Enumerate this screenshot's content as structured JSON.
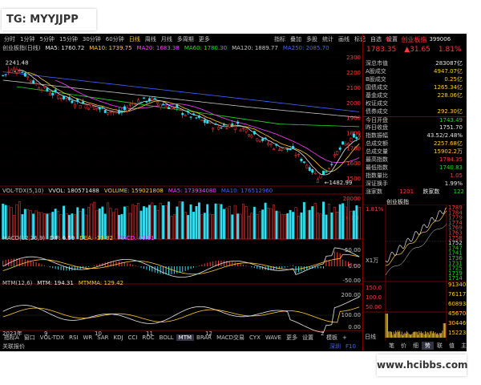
{
  "watermark_tl": "TG: MYYJJPP",
  "watermark_br": "www.hcibbs.com",
  "toolbar": {
    "left": [
      {
        "label": "分时",
        "active": false
      },
      {
        "label": "1分钟",
        "active": false
      },
      {
        "label": "5分钟",
        "active": false
      },
      {
        "label": "15分钟",
        "active": false
      },
      {
        "label": "30分钟",
        "active": false
      },
      {
        "label": "60分钟",
        "active": false
      },
      {
        "label": "日线",
        "active": true
      },
      {
        "label": "周线",
        "active": false
      },
      {
        "label": "月线",
        "active": false
      },
      {
        "label": "多周期",
        "active": false
      },
      {
        "label": "更多",
        "active": false
      }
    ],
    "right": [
      "指标",
      "叠加",
      "多股",
      "统计",
      "画线",
      "标记",
      "自选",
      "设置"
    ]
  },
  "header": {
    "code_letter": "G",
    "index_name": "创业板指",
    "index_code": "399006",
    "last": "1783.35",
    "change": "▲31.65",
    "pct": "1.81%"
  },
  "ma_legend": {
    "title": "创业板指(日线)",
    "items": [
      {
        "label": "MA5: 1760.72",
        "color": "#e8e8e8"
      },
      {
        "label": "MA10: 1739.75",
        "color": "#ffcc33"
      },
      {
        "label": "MA20: 1683.38",
        "color": "#ff44ff"
      },
      {
        "label": "MA60: 1780.30",
        "color": "#22dd22"
      },
      {
        "label": "MA120: 1889.77",
        "color": "#c8c8c8"
      },
      {
        "label": "MA250: 2085.70",
        "color": "#4466ff"
      }
    ]
  },
  "price_labels": {
    "high": "2241.48",
    "low": "1482.99"
  },
  "price_axis": [
    "2300",
    "2200",
    "2100",
    "2000",
    "1900",
    "1800",
    "1700",
    "1600",
    "1500"
  ],
  "vol_legend": {
    "title": "VOL-TDX(5,10)",
    "items": [
      {
        "label": "VVOL: 180571488",
        "color": "#e8e8e8"
      },
      {
        "label": "VOLUME: 159021808",
        "color": "#ffcc33"
      },
      {
        "label": "MA5: 173934080",
        "color": "#ff44ff"
      },
      {
        "label": "MA10: 176512960",
        "color": "#4466ff"
      }
    ]
  },
  "vol_axis": [
    "20000",
    "10000"
  ],
  "macd_legend": {
    "title": "MACD(12,26,9)",
    "items": [
      {
        "label": "DIF: 6.59",
        "color": "#e8e8e8"
      },
      {
        "label": "DEA: -13.82",
        "color": "#ffcc33"
      },
      {
        "label": "MACD: 40.81",
        "color": "#ff44ff"
      }
    ]
  },
  "macd_axis": [
    "50.00",
    "0.00",
    "-50.00"
  ],
  "mtm_legend": {
    "title": "MTM(12,6)",
    "items": [
      {
        "label": "MTM: 194.31",
        "color": "#e8e8e8"
      },
      {
        "label": "MTMMA: 129.42",
        "color": "#ffcc33"
      }
    ]
  },
  "mtm_axis": [
    "200.00",
    "100.00",
    "0.00"
  ],
  "date_axis": [
    "2023年",
    "9",
    "10",
    "11",
    "12",
    "2"
  ],
  "bottom_tabs": {
    "items": [
      "指标A",
      "窗口",
      "VOL-TDX",
      "RSI",
      "WR",
      "SAR",
      "KDJ",
      "CCI",
      "ROC",
      "BOLL",
      "MTM",
      "BRAR",
      "MACD交易",
      "CYX",
      "WAVE",
      "更多",
      "设置"
    ],
    "active": "MTM",
    "right": [
      "模板",
      "+"
    ]
  },
  "status": {
    "left": "关联报价",
    "right": [
      "深圳",
      "F10"
    ]
  },
  "stats": [
    {
      "k": "深总市值",
      "v": "283087亿",
      "c": "wht"
    },
    {
      "k": "A股成交",
      "v": "4947.07亿",
      "c": "yel"
    },
    {
      "k": "B股成交",
      "v": "0.25亿",
      "c": "yel"
    },
    {
      "k": "国债成交",
      "v": "1265.34亿",
      "c": "yel"
    },
    {
      "k": "基金成交",
      "v": "228.06亿",
      "c": "yel"
    },
    {
      "k": "权证成交",
      "v": "",
      "c": "yel"
    },
    {
      "k": "债券成交",
      "v": "292.30亿",
      "c": "yel"
    },
    {
      "k": "今日开盘",
      "v": "1743.49",
      "c": "down"
    },
    {
      "k": "昨日收盘",
      "v": "1751.70",
      "c": "wht"
    },
    {
      "k": "指数振幅",
      "v": "43.52/2.48%",
      "c": "wht"
    },
    {
      "k": "总成交额",
      "v": "2257.68亿",
      "c": "yel"
    },
    {
      "k": "总成交量",
      "v": "15902.2万",
      "c": "yel"
    },
    {
      "k": "最高指数",
      "v": "1784.35",
      "c": "up"
    },
    {
      "k": "最低指数",
      "v": "1740.83",
      "c": "down"
    },
    {
      "k": "指数量比",
      "v": "1.05",
      "c": "up"
    },
    {
      "k": "深证换手",
      "v": "1.99%",
      "c": "wht"
    }
  ],
  "updown": {
    "up_label": "涨家数",
    "up": "1201",
    "down_label": "跌家数",
    "down": "122"
  },
  "mini": {
    "title": "创业板指",
    "y_labels": [
      "1789",
      "1784",
      "1779",
      "1774",
      "1769",
      "1763",
      "1758",
      "1752",
      "1747",
      "1741",
      "1736",
      "1731",
      "1725",
      "1719",
      "1714"
    ],
    "y_colors": [
      "up",
      "up",
      "up",
      "up",
      "up",
      "up",
      "up",
      "wht",
      "down",
      "down",
      "down",
      "down",
      "down",
      "down",
      "down"
    ],
    "pct_top": "1.81%",
    "vol_labels": [
      "913407",
      "761173",
      "608938",
      "456704",
      "304469",
      "152235"
    ],
    "vol_unit": "X1万",
    "left_nums": [
      "150.0",
      "100.0",
      "50.00"
    ],
    "tabs": [
      "笔",
      "价",
      "细",
      "势",
      "联",
      "值",
      "主"
    ],
    "active_tab": "势",
    "corner": "日线"
  }
}
